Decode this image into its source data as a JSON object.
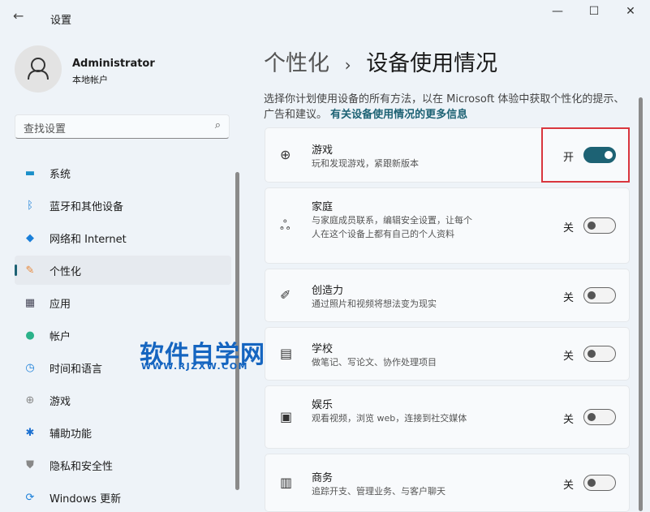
{
  "window": {
    "title": "设置",
    "minimize": "—",
    "maximize": "☐",
    "close": "✕"
  },
  "user": {
    "name": "Administrator",
    "type": "本地帐户"
  },
  "search": {
    "placeholder": "查找设置"
  },
  "sidebar": {
    "items": [
      {
        "label": "系统",
        "icon": "▬",
        "color": "#1a8fc9"
      },
      {
        "label": "蓝牙和其他设备",
        "icon": "ᛒ",
        "color": "#1a7fd9"
      },
      {
        "label": "网络和 Internet",
        "icon": "◆",
        "color": "#1a7fd9"
      },
      {
        "label": "个性化",
        "icon": "✎",
        "color": "#e8883a"
      },
      {
        "label": "应用",
        "icon": "▦",
        "color": "#445"
      },
      {
        "label": "帐户",
        "icon": "●",
        "color": "#2bb28a"
      },
      {
        "label": "时间和语言",
        "icon": "◷",
        "color": "#1a7fd9"
      },
      {
        "label": "游戏",
        "icon": "⊕",
        "color": "#888"
      },
      {
        "label": "辅助功能",
        "icon": "✱",
        "color": "#1a6fd0"
      },
      {
        "label": "隐私和安全性",
        "icon": "⛊",
        "color": "#888"
      },
      {
        "label": "Windows 更新",
        "icon": "⟳",
        "color": "#1a7fd9"
      }
    ]
  },
  "header": {
    "parent": "个性化",
    "sep": "›",
    "current": "设备使用情况"
  },
  "description": {
    "text": "选择你计划使用设备的所有方法，以在 Microsoft 体验中获取个性化的提示、广告和建议。",
    "link": "有关设备使用情况的更多信息"
  },
  "cards": [
    {
      "title": "游戏",
      "sub": "玩和发现游戏，紧跟新版本",
      "state": "开",
      "on": true,
      "icon": "⊕"
    },
    {
      "title": "家庭",
      "sub": "与家庭成员联系，编辑安全设置，让每个人在这个设备上都有自己的个人资料",
      "state": "关",
      "on": false,
      "icon": "ஃ"
    },
    {
      "title": "创造力",
      "sub": "通过照片和视频将想法变为现实",
      "state": "关",
      "on": false,
      "icon": "✐"
    },
    {
      "title": "学校",
      "sub": "做笔记、写论文、协作处理项目",
      "state": "关",
      "on": false,
      "icon": "▤"
    },
    {
      "title": "娱乐",
      "sub": "观看视频，浏览 web，连接到社交媒体",
      "state": "关",
      "on": false,
      "icon": "▣"
    },
    {
      "title": "商务",
      "sub": "追踪开支、管理业务、与客户聊天",
      "state": "关",
      "on": false,
      "icon": "▥"
    }
  ],
  "watermark": {
    "title": "软件自学网",
    "url": "WWW.RJZXW.COM"
  }
}
